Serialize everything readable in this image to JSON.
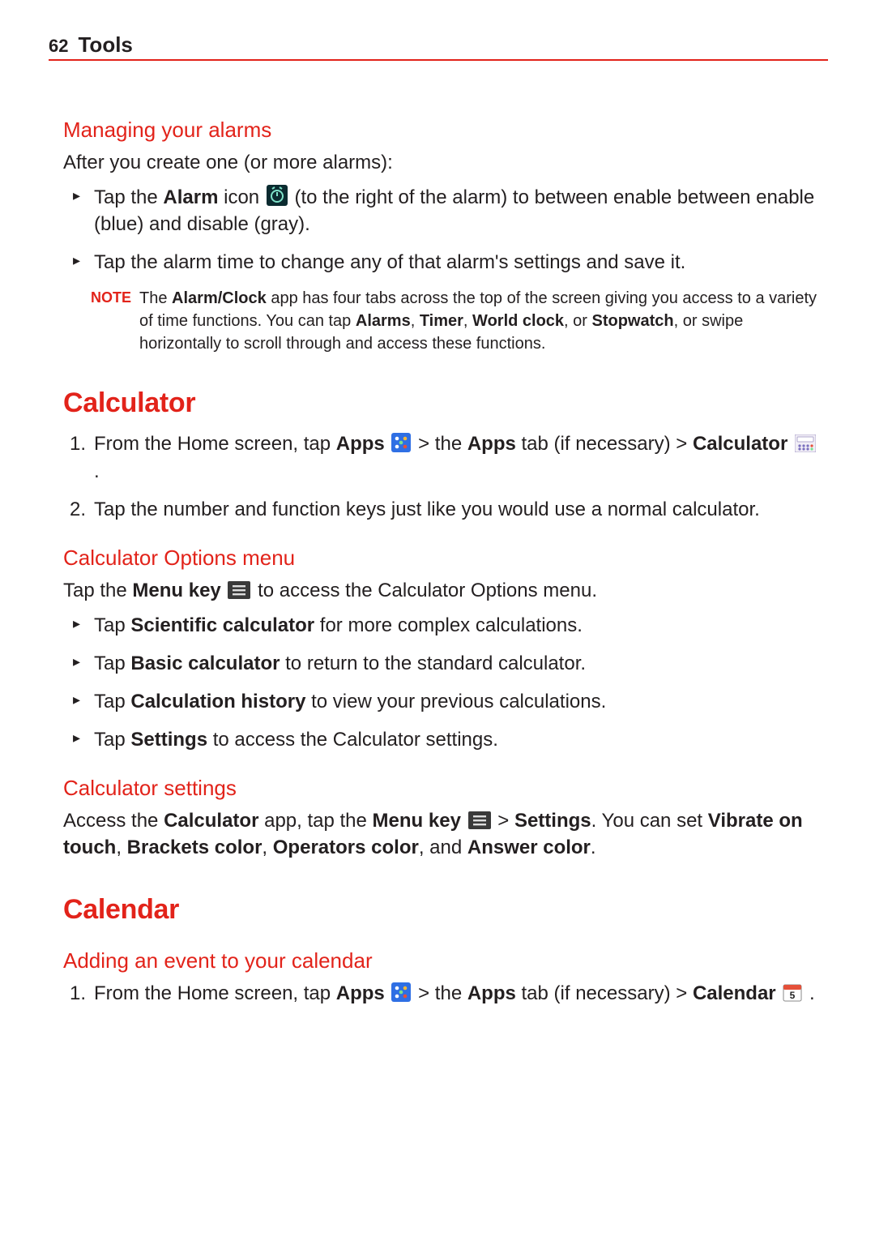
{
  "header": {
    "page_num": "62",
    "chapter": "Tools"
  },
  "s_alarms": {
    "title": "Managing your alarms",
    "intro": "After you create one (or more alarms):",
    "b1_pre": "Tap the ",
    "b1_bold": "Alarm",
    "b1_post1": " icon ",
    "b1_post2": " (to the right of the alarm) to between enable between enable (blue) and disable (gray).",
    "b2": "Tap the alarm time to change any of that alarm's settings and save it.",
    "note_label": "NOTE",
    "note_pre": "The ",
    "note_b1": "Alarm/Clock",
    "note_mid1": " app has four tabs across the top of the screen giving you access to a variety of time functions. You can tap ",
    "note_b2": "Alarms",
    "note_c1": ", ",
    "note_b3": "Timer",
    "note_c2": ", ",
    "note_b4": "World clock",
    "note_c3": ", or ",
    "note_b5": "Stopwatch",
    "note_end": ", or swipe horizontally to scroll through and access these functions."
  },
  "s_calc": {
    "title": "Calculator",
    "l1_pre": "From the Home screen, tap ",
    "l1_b1": "Apps",
    "l1_mid1": "  > the ",
    "l1_b2": "Apps",
    "l1_mid2": " tab (if necessary) > ",
    "l1_b3": "Calculator",
    "l1_end": " .",
    "l2": "Tap the number and function keys just like you would use a normal calculator."
  },
  "s_calcopt": {
    "title": "Calculator Options menu",
    "intro_pre": "Tap the ",
    "intro_b1": "Menu key",
    "intro_post": " to access the Calculator Options menu.",
    "o1_pre": "Tap ",
    "o1_b": "Scientific calculator",
    "o1_post": " for more complex calculations.",
    "o2_pre": "Tap ",
    "o2_b": "Basic calculator",
    "o2_post": " to return to the standard calculator.",
    "o3_pre": "Tap ",
    "o3_b": "Calculation history",
    "o3_post": " to view your previous calculations.",
    "o4_pre": "Tap ",
    "o4_b": "Settings",
    "o4_post": " to access the Calculator settings."
  },
  "s_calcset": {
    "title": "Calculator settings",
    "pre": "Access the ",
    "b1": "Calculator",
    "mid1": " app, tap the ",
    "b2": "Menu key",
    "mid2": " > ",
    "b3": "Settings",
    "mid3": ". You can set ",
    "b4": "Vibrate on touch",
    "c1": ", ",
    "b5": "Brackets color",
    "c2": ", ",
    "b6": "Operators color",
    "c3": ", and ",
    "b7": "Answer color",
    "end": "."
  },
  "s_cal": {
    "title": "Calendar",
    "sub": "Adding an event to your calendar",
    "l1_pre": "From the Home screen, tap ",
    "l1_b1": "Apps",
    "l1_mid1": "  > the ",
    "l1_b2": "Apps",
    "l1_mid2": " tab (if necessary) > ",
    "l1_b3": "Calendar",
    "l1_end": " ."
  }
}
